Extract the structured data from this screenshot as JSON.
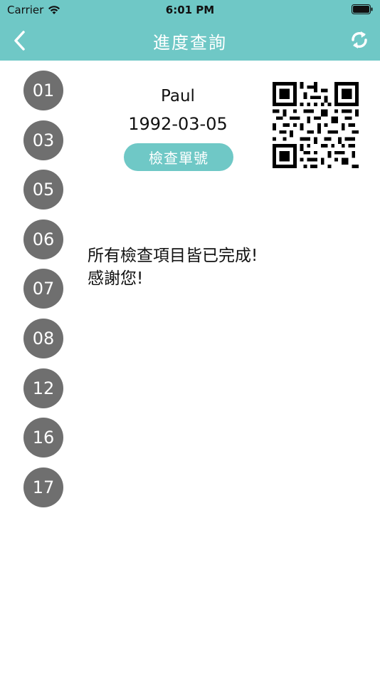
{
  "status_bar": {
    "carrier": "Carrier",
    "time": "6:01 PM"
  },
  "nav": {
    "title": "進度查詢",
    "back_icon": "chevron-left-icon",
    "refresh_icon": "refresh-icon"
  },
  "side_list": {
    "items": [
      "01",
      "03",
      "05",
      "06",
      "07",
      "08",
      "12",
      "16",
      "17"
    ]
  },
  "patient": {
    "name": "Paul",
    "dob": "1992-03-05",
    "exam_number_label": "檢查單號"
  },
  "qr_icon": "qr-code-icon",
  "message": {
    "line1": "所有檢查項目皆已完成!",
    "line2": "感謝您!"
  },
  "colors": {
    "accent": "#6fc8c6",
    "circle": "#6f6f6f"
  }
}
